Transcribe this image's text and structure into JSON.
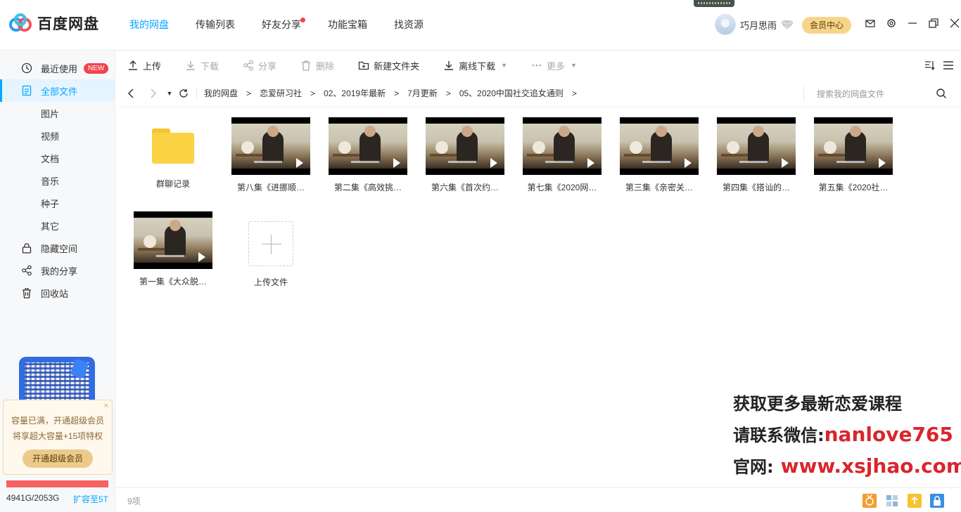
{
  "app": {
    "name": "百度网盘"
  },
  "nav": {
    "items": [
      {
        "label": "我的网盘",
        "active": true
      },
      {
        "label": "传输列表",
        "active": false
      },
      {
        "label": "好友分享",
        "active": false,
        "dot": true
      },
      {
        "label": "功能宝箱",
        "active": false
      },
      {
        "label": "找资源",
        "active": false
      }
    ]
  },
  "user": {
    "name": "巧月思雨",
    "vip_button": "会员中心"
  },
  "window_icons": [
    "mail-icon",
    "settings-icon",
    "minimize-icon",
    "restore-icon",
    "close-icon"
  ],
  "sidebar": {
    "items": [
      {
        "label": "最近使用",
        "icon": "clock-icon",
        "badge": "NEW"
      },
      {
        "label": "全部文件",
        "icon": "document-icon",
        "active": true
      },
      {
        "label": "图片",
        "sub": true
      },
      {
        "label": "视频",
        "sub": true
      },
      {
        "label": "文档",
        "sub": true
      },
      {
        "label": "音乐",
        "sub": true
      },
      {
        "label": "种子",
        "sub": true
      },
      {
        "label": "其它",
        "sub": true
      },
      {
        "label": "隐藏空间",
        "icon": "lock-icon"
      },
      {
        "label": "我的分享",
        "icon": "share-icon"
      },
      {
        "label": "回收站",
        "icon": "trash-icon"
      }
    ],
    "promo": {
      "line1": "容量已满，开通超级会员",
      "line2": "将享超大容量+15项特权",
      "button": "开通超级会员",
      "close": "×"
    },
    "quota": {
      "used_text": "4941G/2053G",
      "expand": "扩容至5T"
    }
  },
  "toolbar": {
    "upload": "上传",
    "download": "下载",
    "share": "分享",
    "delete": "删除",
    "new_folder": "新建文件夹",
    "offline": "离线下载",
    "more": "更多"
  },
  "breadcrumb": {
    "items": [
      "我的网盘",
      "恋爱研习社",
      "02、2019年最新",
      "7月更新",
      "05、2020中国社交追女通则"
    ],
    "sep": ">"
  },
  "search": {
    "placeholder": "搜索我的网盘文件"
  },
  "files": [
    {
      "name": "群聊记录",
      "type": "folder"
    },
    {
      "name": "第八集《进挪顺…",
      "type": "video"
    },
    {
      "name": "第二集《高效挑…",
      "type": "video"
    },
    {
      "name": "第六集《首次约…",
      "type": "video"
    },
    {
      "name": "第七集《2020网…",
      "type": "video"
    },
    {
      "name": "第三集《亲密关…",
      "type": "video"
    },
    {
      "name": "第四集《搭讪的…",
      "type": "video"
    },
    {
      "name": "第五集《2020社…",
      "type": "video"
    },
    {
      "name": "第一集《大众脱…",
      "type": "video"
    },
    {
      "name": "上传文件",
      "type": "upload"
    }
  ],
  "watermark": {
    "line1": "获取更多最新恋爱课程",
    "line2_prefix": "请联系微信:",
    "line2_value": "nanlove765",
    "line3_prefix": "官网:",
    "line3_value": "www.xsjhao.com"
  },
  "status": {
    "count": "9项"
  },
  "colors": {
    "accent": "#06a7ff",
    "vip": "#f6d58a",
    "quota_bar": "#f66262",
    "badge": "#f0444a",
    "watermark_red": "#d8262c"
  }
}
